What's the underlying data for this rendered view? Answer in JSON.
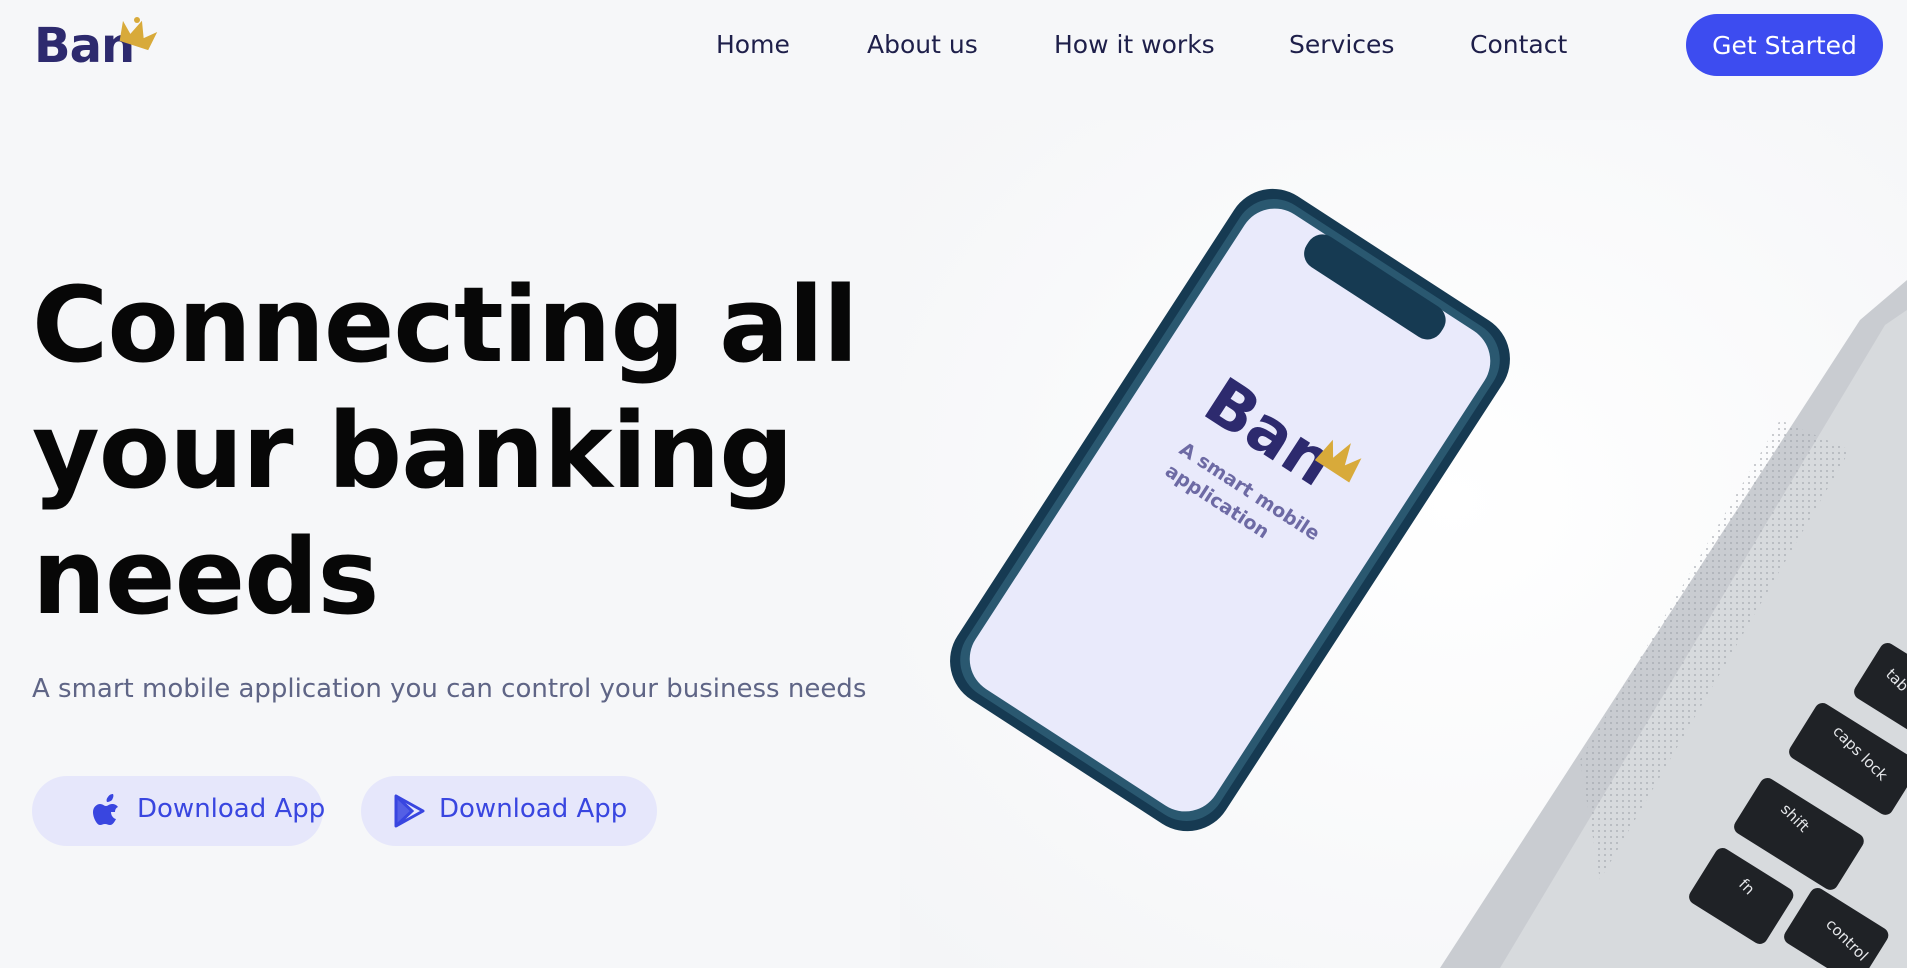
{
  "brand": {
    "name": "Ban",
    "text_color": "#2d2a6e",
    "crown_color": "#d8aa3a"
  },
  "nav": {
    "items": [
      {
        "label": "Home"
      },
      {
        "label": "About us"
      },
      {
        "label": "How it works"
      },
      {
        "label": "Services"
      },
      {
        "label": "Contact"
      }
    ],
    "cta_label": "Get Started"
  },
  "hero": {
    "headline_lines": [
      "Connecting all",
      "your banking",
      "needs"
    ],
    "subtitle": "A smart mobile application you can control your business needs",
    "buttons": [
      {
        "label": "Download App",
        "icon": "apple-icon"
      },
      {
        "label": "Download App",
        "icon": "play-store-icon"
      }
    ],
    "phone_screen": {
      "brand": "Ban",
      "tagline_lines": [
        "A smart mobile",
        "application"
      ]
    },
    "laptop_keys": [
      "tab",
      "caps lock",
      "shift",
      "fn",
      "control"
    ]
  },
  "colors": {
    "accent": "#3d4cf0",
    "button_bg": "#e6e7fb",
    "button_text": "#3946e0",
    "headline": "#070707",
    "nav_text": "#1e1f4a",
    "subtitle": "#5f6586",
    "page_bg": "#f6f7f9"
  }
}
